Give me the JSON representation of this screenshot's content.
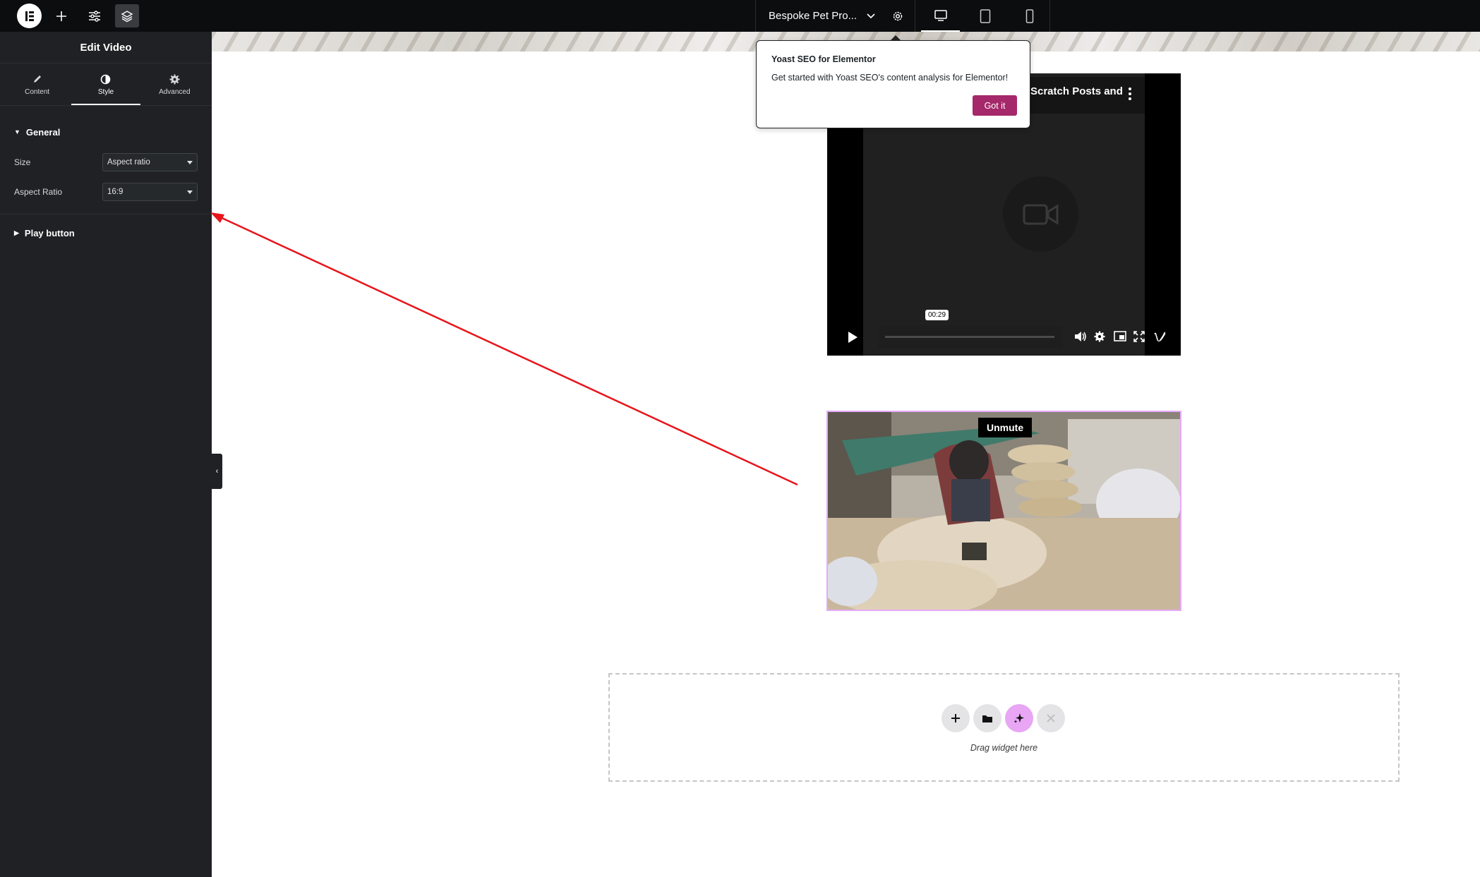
{
  "topbar": {
    "document_title": "Bespoke Pet Pro..."
  },
  "panel": {
    "title": "Edit Video",
    "tabs": [
      {
        "label": "Content",
        "icon": "pencil-icon"
      },
      {
        "label": "Style",
        "icon": "half-circle-icon",
        "active": true
      },
      {
        "label": "Advanced",
        "icon": "gear-icon"
      }
    ],
    "sections": {
      "general": {
        "label": "General",
        "controls": [
          {
            "label": "Size",
            "value": "Aspect ratio"
          },
          {
            "label": "Aspect Ratio",
            "value": "16:9"
          }
        ]
      },
      "play_button": {
        "label": "Play button"
      }
    }
  },
  "video1": {
    "title_fragment": "Scratch Posts and",
    "timestamp": "00:29"
  },
  "video2": {
    "unmute_label": "Unmute"
  },
  "dropzone": {
    "text": "Drag widget here"
  },
  "yoast": {
    "title": "Yoast SEO for Elementor",
    "body": "Get started with Yoast SEO's content analysis for Elementor!",
    "button": "Got it"
  },
  "colors": {
    "panel_bg": "#1f2124",
    "topbar_bg": "#0c0d0e",
    "yoast_button": "#a4286a",
    "selected_widget_border": "#e5aafb",
    "ai_button": "#e8a6f4",
    "annotation_arrow": "#e8141b"
  }
}
